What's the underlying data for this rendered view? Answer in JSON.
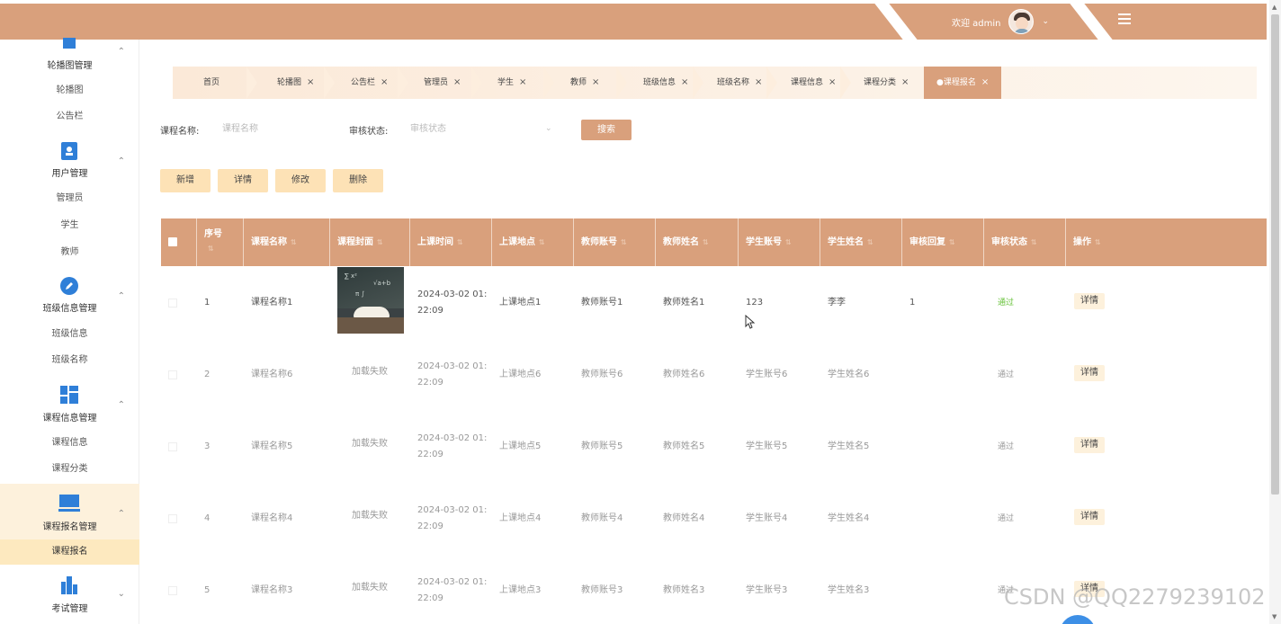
{
  "header": {
    "welcome": "欢迎 admin",
    "chevron": "⌄",
    "menu_icon": "menu-icon"
  },
  "sidebar": {
    "groups": [
      {
        "title": "轮播图管理",
        "icon": "carousel-icon",
        "items": [
          "轮播图",
          "公告栏"
        ]
      },
      {
        "title": "用户管理",
        "icon": "user-icon",
        "items": [
          "管理员",
          "学生",
          "教师"
        ]
      },
      {
        "title": "班级信息管理",
        "icon": "edit-icon",
        "items": [
          "班级信息",
          "班级名称"
        ]
      },
      {
        "title": "课程信息管理",
        "icon": "grid-icon",
        "items": [
          "课程信息",
          "课程分类"
        ]
      },
      {
        "title": "课程报名管理",
        "icon": "monitor-icon",
        "items": [
          "课程报名"
        ]
      },
      {
        "title": "考试管理",
        "icon": "chart-icon",
        "items": []
      }
    ]
  },
  "tabs": [
    "首页",
    "轮播图",
    "公告栏",
    "管理员",
    "学生",
    "教师",
    "班级信息",
    "班级名称",
    "课程信息",
    "课程分类",
    "●课程报名"
  ],
  "tab_close": "×",
  "search": {
    "course_label": "课程名称:",
    "course_placeholder": "课程名称",
    "status_label": "审核状态:",
    "status_placeholder": "审核状态",
    "button": "搜索"
  },
  "actions": {
    "add": "新增",
    "detail": "详情",
    "edit": "修改",
    "delete": "删除"
  },
  "table": {
    "columns": [
      "序号",
      "课程名称",
      "课程封面",
      "上课时间",
      "上课地点",
      "教师账号",
      "教师姓名",
      "学生账号",
      "学生姓名",
      "审核回复",
      "审核状态",
      "操作"
    ],
    "rows": [
      {
        "no": "1",
        "name": "课程名称1",
        "cover": "",
        "time1": "2024-03-02 01:",
        "time2": "22:09",
        "place": "上课地点1",
        "tacct": "教师账号1",
        "tname": "教师姓名1",
        "sacct": "123",
        "sname": "李李",
        "reply": "1",
        "status": "通过",
        "op": "详情"
      },
      {
        "no": "2",
        "name": "课程名称6",
        "cover": "加载失败",
        "time1": "2024-03-02 01:",
        "time2": "22:09",
        "place": "上课地点6",
        "tacct": "教师账号6",
        "tname": "教师姓名6",
        "sacct": "学生账号6",
        "sname": "学生姓名6",
        "reply": "",
        "status": "通过",
        "op": "详情"
      },
      {
        "no": "3",
        "name": "课程名称5",
        "cover": "加载失败",
        "time1": "2024-03-02 01:",
        "time2": "22:09",
        "place": "上课地点5",
        "tacct": "教师账号5",
        "tname": "教师姓名5",
        "sacct": "学生账号5",
        "sname": "学生姓名5",
        "reply": "",
        "status": "通过",
        "op": "详情"
      },
      {
        "no": "4",
        "name": "课程名称4",
        "cover": "加载失败",
        "time1": "2024-03-02 01:",
        "time2": "22:09",
        "place": "上课地点4",
        "tacct": "教师账号4",
        "tname": "教师姓名4",
        "sacct": "学生账号4",
        "sname": "学生姓名4",
        "reply": "",
        "status": "通过",
        "op": "详情"
      },
      {
        "no": "5",
        "name": "课程名称3",
        "cover": "加载失败",
        "time1": "2024-03-02 01:",
        "time2": "22:09",
        "place": "上课地点3",
        "tacct": "教师账号3",
        "tname": "教师姓名3",
        "sacct": "学生账号3",
        "sname": "学生姓名3",
        "reply": "",
        "status": "通过",
        "op": "详情"
      }
    ]
  },
  "watermark": "CSDN @QQ2279239102",
  "colors": {
    "accent": "#d9a07c",
    "button_bg": "#fde2b6",
    "status_ok": "#67c23a"
  }
}
